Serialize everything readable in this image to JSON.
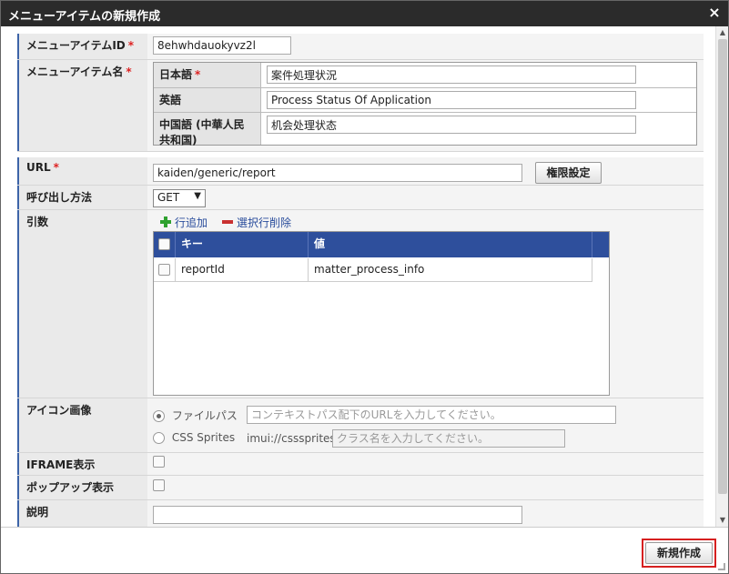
{
  "dialog": {
    "title": "メニューアイテムの新規作成",
    "close_glyph": "×"
  },
  "fields": {
    "item_id": {
      "label": "メニューアイテムID",
      "required_mark": "*",
      "value": "8ehwhdauokyvz2l"
    },
    "item_name": {
      "label": "メニューアイテム名",
      "required_mark": "*",
      "languages": [
        {
          "label": "日本語",
          "required_mark": "*",
          "value": "案件処理状況"
        },
        {
          "label": "英語",
          "value": "Process Status Of Application"
        },
        {
          "label": "中国語 (中華人民共和国)",
          "value": "机会处理状态"
        }
      ]
    },
    "url": {
      "label": "URL",
      "required_mark": "*",
      "value": "kaiden/generic/report",
      "button_label": "権限設定"
    },
    "call_method": {
      "label": "呼び出し方法",
      "selected": "GET",
      "arrow": "▼"
    },
    "args": {
      "label": "引数",
      "add_row_label": "行追加",
      "delete_selected_label": "選択行削除",
      "columns": [
        "キー",
        "値"
      ],
      "rows": [
        {
          "key": "reportId",
          "value": "matter_process_info"
        }
      ]
    },
    "icon_image": {
      "label": "アイコン画像",
      "file_path_label": "ファイルパス",
      "file_path_placeholder": "コンテキストパス配下のURLを入力してください。",
      "css_sprites_label": "CSS Sprites",
      "css_sprites_prefix": "imui://csssprites/",
      "css_sprites_placeholder": "クラス名を入力してください。"
    },
    "iframe": {
      "label": "IFRAME表示"
    },
    "popup": {
      "label": "ポップアップ表示"
    },
    "description": {
      "label": "説明",
      "value": ""
    }
  },
  "footer": {
    "create_label": "新規作成"
  },
  "colors": {
    "title_bar": "#2b2b2b",
    "grid_header": "#2e4f9c",
    "accent_border": "#3d64a8",
    "highlight": "#d62020",
    "required": "#dd2222"
  }
}
